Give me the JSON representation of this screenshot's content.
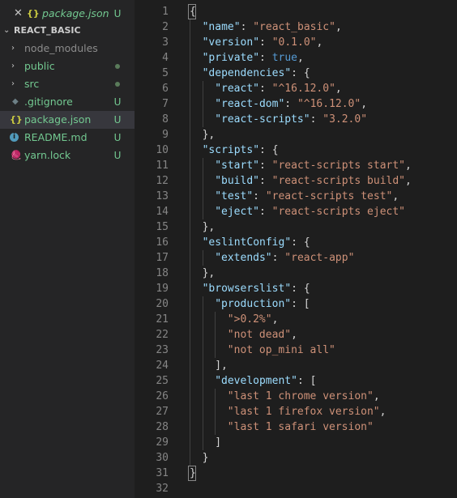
{
  "explorer": {
    "open_file": {
      "close_glyph": "✕",
      "icon": "{}",
      "name": "package.json",
      "status": "U"
    },
    "project": {
      "chevron": "⌄",
      "name": "REACT_BASIC"
    },
    "items": [
      {
        "type": "folder",
        "name": "node_modules",
        "status": "",
        "muted": true
      },
      {
        "type": "folder",
        "name": "public",
        "status": "dot"
      },
      {
        "type": "folder",
        "name": "src",
        "status": "dot"
      },
      {
        "type": "file",
        "icon": "git",
        "name": ".gitignore",
        "status": "U"
      },
      {
        "type": "file",
        "icon": "json",
        "name": "package.json",
        "status": "U",
        "selected": true
      },
      {
        "type": "file",
        "icon": "info",
        "name": "README.md",
        "status": "U"
      },
      {
        "type": "file",
        "icon": "yarn",
        "name": "yarn.lock",
        "status": "U"
      }
    ],
    "glyphs": {
      "chevron_right": "›",
      "git": "◆",
      "json": "{}",
      "info": "i",
      "yarn": "🧶"
    }
  },
  "editor": {
    "lines": [
      [
        [
          "p",
          "{"
        ]
      ],
      [
        [
          "k",
          "\"name\""
        ],
        [
          "p",
          ": "
        ],
        [
          "s",
          "\"react_basic\""
        ],
        [
          "p",
          ","
        ]
      ],
      [
        [
          "k",
          "\"version\""
        ],
        [
          "p",
          ": "
        ],
        [
          "s",
          "\"0.1.0\""
        ],
        [
          "p",
          ","
        ]
      ],
      [
        [
          "k",
          "\"private\""
        ],
        [
          "p",
          ": "
        ],
        [
          "b",
          "true"
        ],
        [
          "p",
          ","
        ]
      ],
      [
        [
          "k",
          "\"dependencies\""
        ],
        [
          "p",
          ": {"
        ]
      ],
      [
        [
          "k",
          "\"react\""
        ],
        [
          "p",
          ": "
        ],
        [
          "s",
          "\"^16.12.0\""
        ],
        [
          "p",
          ","
        ]
      ],
      [
        [
          "k",
          "\"react-dom\""
        ],
        [
          "p",
          ": "
        ],
        [
          "s",
          "\"^16.12.0\""
        ],
        [
          "p",
          ","
        ]
      ],
      [
        [
          "k",
          "\"react-scripts\""
        ],
        [
          "p",
          ": "
        ],
        [
          "s",
          "\"3.2.0\""
        ]
      ],
      [
        [
          "p",
          "},"
        ]
      ],
      [
        [
          "k",
          "\"scripts\""
        ],
        [
          "p",
          ": {"
        ]
      ],
      [
        [
          "k",
          "\"start\""
        ],
        [
          "p",
          ": "
        ],
        [
          "s",
          "\"react-scripts start\""
        ],
        [
          "p",
          ","
        ]
      ],
      [
        [
          "k",
          "\"build\""
        ],
        [
          "p",
          ": "
        ],
        [
          "s",
          "\"react-scripts build\""
        ],
        [
          "p",
          ","
        ]
      ],
      [
        [
          "k",
          "\"test\""
        ],
        [
          "p",
          ": "
        ],
        [
          "s",
          "\"react-scripts test\""
        ],
        [
          "p",
          ","
        ]
      ],
      [
        [
          "k",
          "\"eject\""
        ],
        [
          "p",
          ": "
        ],
        [
          "s",
          "\"react-scripts eject\""
        ]
      ],
      [
        [
          "p",
          "},"
        ]
      ],
      [
        [
          "k",
          "\"eslintConfig\""
        ],
        [
          "p",
          ": {"
        ]
      ],
      [
        [
          "k",
          "\"extends\""
        ],
        [
          "p",
          ": "
        ],
        [
          "s",
          "\"react-app\""
        ]
      ],
      [
        [
          "p",
          "},"
        ]
      ],
      [
        [
          "k",
          "\"browserslist\""
        ],
        [
          "p",
          ": {"
        ]
      ],
      [
        [
          "k",
          "\"production\""
        ],
        [
          "p",
          ": ["
        ]
      ],
      [
        [
          "s",
          "\">0.2%\""
        ],
        [
          "p",
          ","
        ]
      ],
      [
        [
          "s",
          "\"not dead\""
        ],
        [
          "p",
          ","
        ]
      ],
      [
        [
          "s",
          "\"not op_mini all\""
        ]
      ],
      [
        [
          "p",
          "],"
        ]
      ],
      [
        [
          "k",
          "\"development\""
        ],
        [
          "p",
          ": ["
        ]
      ],
      [
        [
          "s",
          "\"last 1 chrome version\""
        ],
        [
          "p",
          ","
        ]
      ],
      [
        [
          "s",
          "\"last 1 firefox version\""
        ],
        [
          "p",
          ","
        ]
      ],
      [
        [
          "s",
          "\"last 1 safari version\""
        ]
      ],
      [
        [
          "p",
          "]"
        ]
      ],
      [
        [
          "p",
          "}"
        ]
      ],
      [
        [
          "p",
          "}"
        ]
      ],
      []
    ]
  }
}
